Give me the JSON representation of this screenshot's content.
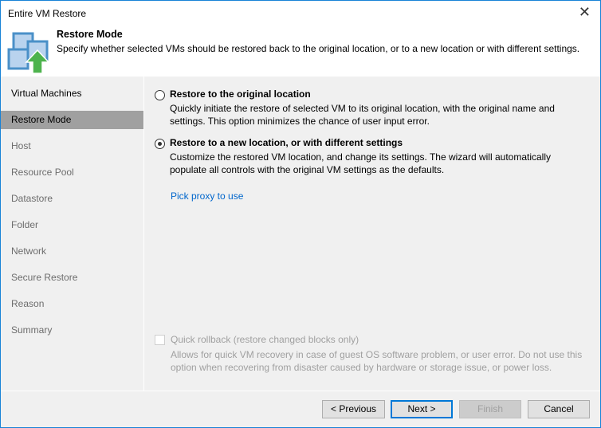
{
  "window": {
    "title": "Entire VM Restore"
  },
  "header": {
    "title": "Restore Mode",
    "description": "Specify whether selected VMs should be restored back to the original location, or to a new location or with different settings."
  },
  "sidebar": {
    "items": [
      {
        "label": "Virtual Machines",
        "state": "done"
      },
      {
        "label": "Restore Mode",
        "state": "active"
      },
      {
        "label": "Host",
        "state": "pending"
      },
      {
        "label": "Resource Pool",
        "state": "pending"
      },
      {
        "label": "Datastore",
        "state": "pending"
      },
      {
        "label": "Folder",
        "state": "pending"
      },
      {
        "label": "Network",
        "state": "pending"
      },
      {
        "label": "Secure Restore",
        "state": "pending"
      },
      {
        "label": "Reason",
        "state": "pending"
      },
      {
        "label": "Summary",
        "state": "pending"
      }
    ]
  },
  "options": [
    {
      "label": "Restore to the original location",
      "description": "Quickly initiate the restore of selected VM to its original location, with the original name and settings. This option minimizes the chance of user input error.",
      "selected": false
    },
    {
      "label": "Restore to a new location, or with different settings",
      "description": "Customize the restored VM location, and change its settings. The wizard will automatically populate all controls with the original VM settings as the defaults.",
      "selected": true
    }
  ],
  "pick_proxy_link": "Pick proxy to use",
  "quick_rollback": {
    "label": "Quick rollback (restore changed blocks only)",
    "description": "Allows for quick VM recovery in case of guest OS software problem, or user error. Do not use this option when recovering from disaster caused by hardware or storage issue, or power loss.",
    "checked": false,
    "enabled": false
  },
  "buttons": {
    "previous": "< Previous",
    "next": "Next >",
    "finish": "Finish",
    "cancel": "Cancel"
  }
}
